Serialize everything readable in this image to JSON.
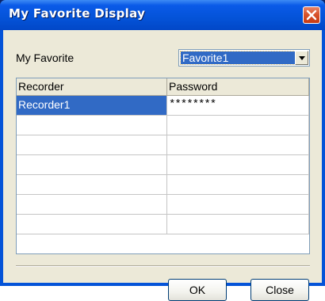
{
  "window": {
    "title": "My Favorite Display"
  },
  "favorite": {
    "label": "My Favorite",
    "selected": "Favorite1"
  },
  "table": {
    "columns": [
      "Recorder",
      "Password"
    ],
    "rows": [
      {
        "recorder": "Recorder1",
        "password": "********",
        "selected": true
      },
      {
        "recorder": "",
        "password": ""
      },
      {
        "recorder": "",
        "password": ""
      },
      {
        "recorder": "",
        "password": ""
      },
      {
        "recorder": "",
        "password": ""
      },
      {
        "recorder": "",
        "password": ""
      },
      {
        "recorder": "",
        "password": ""
      }
    ]
  },
  "buttons": {
    "ok": "OK",
    "close": "Close"
  },
  "icons": {
    "close": "close-icon",
    "dropdown": "chevron-down-icon"
  },
  "colors": {
    "titlebar": "#0453d8",
    "selection": "#316ac5",
    "close_button": "#d9542c",
    "client_bg": "#ece9d8"
  }
}
